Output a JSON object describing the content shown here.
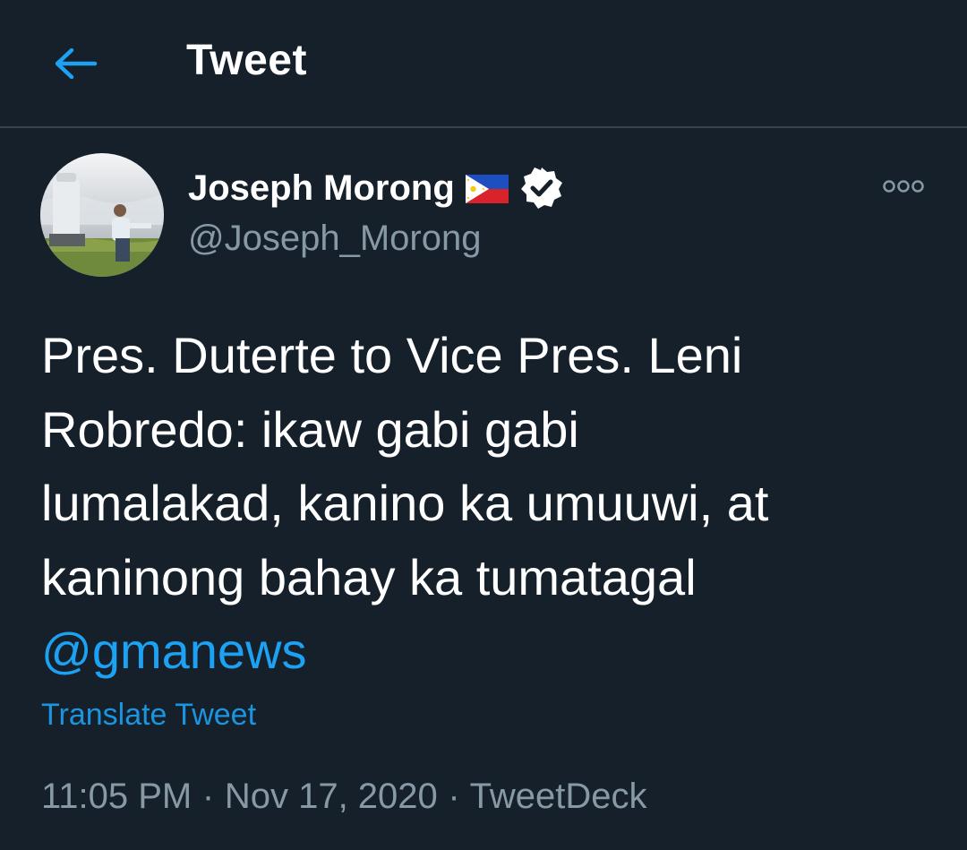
{
  "colors": {
    "background": "#15202b",
    "divider": "#38444d",
    "accent": "#1da1f2",
    "secondary_text": "#8899a6"
  },
  "header": {
    "back_icon": "arrow-left-icon",
    "title": "Tweet"
  },
  "author": {
    "name": "Joseph Morong",
    "flag_icon": "philippines-flag-icon",
    "verified_icon": "verified-badge-icon",
    "handle": "@Joseph_Morong"
  },
  "more_icon": "more-options-icon",
  "tweet": {
    "lines": [
      "Pres. Duterte to Vice Pres. Leni",
      "Robredo:  ikaw gabi gabi",
      "lumalakad, kanino ka umuuwi, at",
      "kaninong bahay ka tumatagal"
    ],
    "mention": "@gmanews"
  },
  "translate_label": "Translate Tweet",
  "meta": {
    "time": "11:05 PM",
    "separator": "·",
    "date": "Nov 17, 2020",
    "source": "TweetDeck"
  }
}
